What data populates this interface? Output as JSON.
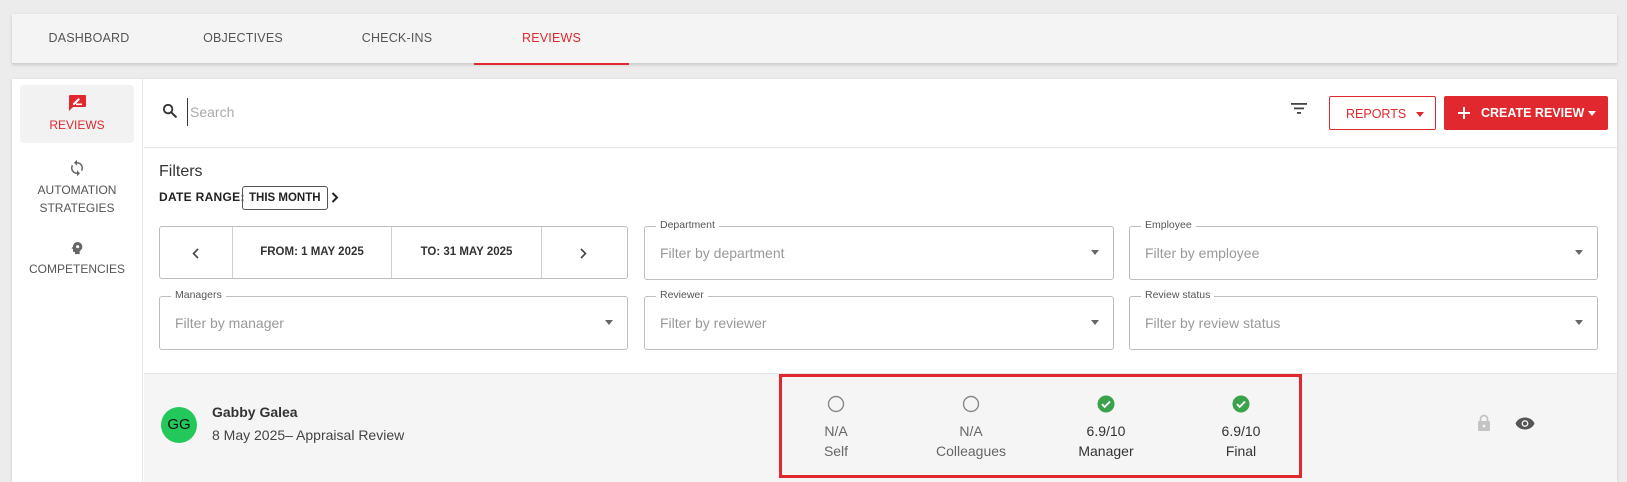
{
  "tabs": [
    {
      "label": "DASHBOARD"
    },
    {
      "label": "OBJECTIVES"
    },
    {
      "label": "CHECK-INS"
    },
    {
      "label": "REVIEWS"
    }
  ],
  "sidebar": {
    "items": [
      {
        "label": "REVIEWS",
        "icon": "rate-review-icon"
      },
      {
        "label": "AUTOMATION STRATEGIES",
        "icon": "sync-icon"
      },
      {
        "label": "COMPETENCIES",
        "icon": "head-gear-icon"
      }
    ]
  },
  "search": {
    "placeholder": "Search",
    "value": ""
  },
  "toolbar": {
    "reports_label": "REPORTS",
    "create_label": "CREATE REVIEW"
  },
  "filters": {
    "title": "Filters",
    "date_range_label": "DATE RANGE:",
    "date_range_value": "THIS MONTH",
    "from": "FROM: 1 MAY 2025",
    "to": "TO: 31 MAY 2025",
    "fields": [
      {
        "label": "Department",
        "placeholder": "Filter by department"
      },
      {
        "label": "Employee",
        "placeholder": "Filter by employee"
      },
      {
        "label": "Managers",
        "placeholder": "Filter by manager"
      },
      {
        "label": "Reviewer",
        "placeholder": "Filter by reviewer"
      },
      {
        "label": "Review status",
        "placeholder": "Filter by review status"
      }
    ]
  },
  "review": {
    "initials": "GG",
    "name": "Gabby Galea",
    "subtitle": "8 May 2025– Appraisal Review",
    "scores": [
      {
        "value": "N/A",
        "label": "Self",
        "status": "pending"
      },
      {
        "value": "N/A",
        "label": "Colleagues",
        "status": "pending"
      },
      {
        "value": "6.9/10",
        "label": "Manager",
        "status": "done"
      },
      {
        "value": "6.9/10",
        "label": "Final",
        "status": "done"
      }
    ]
  },
  "colors": {
    "accent": "#e0282e",
    "avatar": "#22c95a",
    "check": "#3aa24a"
  }
}
